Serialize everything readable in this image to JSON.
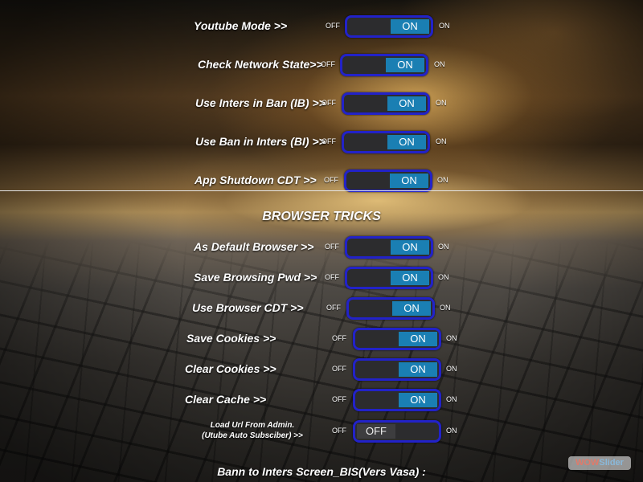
{
  "settings": [
    {
      "label": "Youtube Mode >>",
      "off_label": "OFF",
      "on_label": "ON",
      "state": "ON"
    },
    {
      "label": "Check Network State>>",
      "off_label": "OFF",
      "on_label": "ON",
      "state": "ON"
    },
    {
      "label": "Use Inters in Ban (IB) >>",
      "off_label": "OFF",
      "on_label": "ON",
      "state": "ON"
    },
    {
      "label": "Use Ban in Inters (BI) >>",
      "off_label": "OFF",
      "on_label": "ON",
      "state": "ON"
    },
    {
      "label": "App Shutdown CDT >>",
      "off_label": "OFF",
      "on_label": "ON",
      "state": "ON"
    }
  ],
  "browser_section": {
    "title": "BROWSER TRICKS",
    "items": [
      {
        "label": "As Default Browser  >>",
        "off_label": "OFF",
        "on_label": "ON",
        "state": "ON"
      },
      {
        "label": "Save Browsing Pwd >>",
        "off_label": "OFF",
        "on_label": "ON",
        "state": "ON"
      },
      {
        "label": "Use Browser CDT >>",
        "off_label": "OFF",
        "on_label": "ON",
        "state": "ON"
      },
      {
        "label": "Save Cookies >>",
        "off_label": "OFF",
        "on_label": "ON",
        "state": "ON"
      },
      {
        "label": "Clear Cookies >>",
        "off_label": "OFF",
        "on_label": "ON",
        "state": "ON"
      },
      {
        "label": "Clear Cache >>",
        "off_label": "OFF",
        "on_label": "ON",
        "state": "ON"
      },
      {
        "label_line1": "Load Url From Admin.",
        "label_line2": "(Utube Auto Subsciber)  >>",
        "off_label": "OFF",
        "on_label": "ON",
        "state": "OFF"
      }
    ]
  },
  "bottom_label": "Bann to Inters Screen_BIS(Vers Vasa) :",
  "watermark": {
    "part1": "WOW",
    "part2": "Slider"
  },
  "colors": {
    "toggle_border": "#2222c8",
    "knob_on": "#1a7fb3",
    "knob_off": "#3d3d3f",
    "track": "#2c2c2e"
  }
}
